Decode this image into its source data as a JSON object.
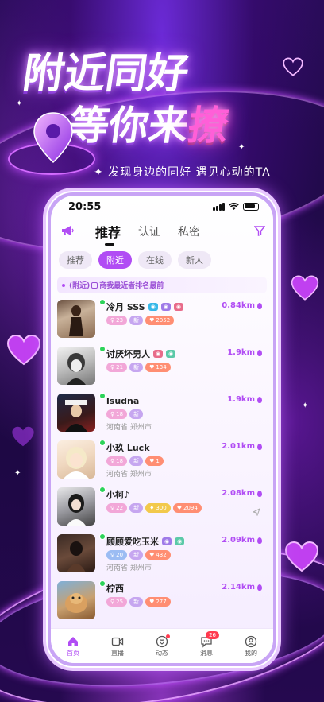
{
  "promo": {
    "headline_1": "附近同好",
    "headline_2a": "等你来",
    "headline_2b": "撩",
    "subline": "✦ 发现身边的同好  遇见心动的TA"
  },
  "status_bar": {
    "time": "20:55"
  },
  "nav": {
    "tabs": [
      {
        "label": "推荐",
        "active": true
      },
      {
        "label": "认证",
        "active": false
      },
      {
        "label": "私密",
        "active": false
      }
    ]
  },
  "filter_chips": [
    {
      "label": "推荐",
      "active": false
    },
    {
      "label": "附近",
      "active": true
    },
    {
      "label": "在线",
      "active": false
    },
    {
      "label": "新人",
      "active": false
    }
  ],
  "notice": {
    "prefix": "(附近)",
    "text": "商我最近者排名最前"
  },
  "users": [
    {
      "name": "冷月 SSS",
      "distance": "0.84km",
      "age": "23",
      "level": "新",
      "heat": "2052",
      "location": "",
      "tags": [
        "id",
        "face",
        "real"
      ]
    },
    {
      "name": "讨厌坏男人",
      "distance": "1.9km",
      "age": "21",
      "level": "新",
      "heat": "134",
      "location": "",
      "tags": [
        "real",
        "vip"
      ]
    },
    {
      "name": "lsudna",
      "distance": "1.9km",
      "age": "18",
      "level": "新",
      "heat": "",
      "location": "河南省 郑州市",
      "tags": []
    },
    {
      "name": "小玖 Luck",
      "distance": "2.01km",
      "age": "18",
      "level": "新",
      "heat": "1",
      "location": "河南省 郑州市",
      "tags": []
    },
    {
      "name": "小柯♪",
      "distance": "2.08km",
      "age": "22",
      "level": "新",
      "gold": "300",
      "heat": "2094",
      "location": "",
      "tags": []
    },
    {
      "name": "顾顾爱吃玉米",
      "distance": "2.09km",
      "age": "20",
      "level": "新",
      "heat": "432",
      "location": "河南省 郑州市",
      "tags": [
        "face",
        "vip"
      ]
    },
    {
      "name": "柠西",
      "distance": "2.14km",
      "age": "25",
      "level": "新",
      "heat": "277",
      "location": "",
      "tags": []
    }
  ],
  "tab_bar": {
    "items": [
      {
        "label": "首页",
        "icon": "home-icon",
        "active": true
      },
      {
        "label": "直播",
        "icon": "live-icon",
        "active": false
      },
      {
        "label": "动态",
        "icon": "moments-icon",
        "active": false
      },
      {
        "label": "消息",
        "icon": "message-icon",
        "active": false,
        "badge": "26"
      },
      {
        "label": "我的",
        "icon": "profile-icon",
        "active": false
      }
    ]
  },
  "colors": {
    "accent": "#b14df4",
    "online": "#2dd35a",
    "badge": "#ff3b4f"
  }
}
